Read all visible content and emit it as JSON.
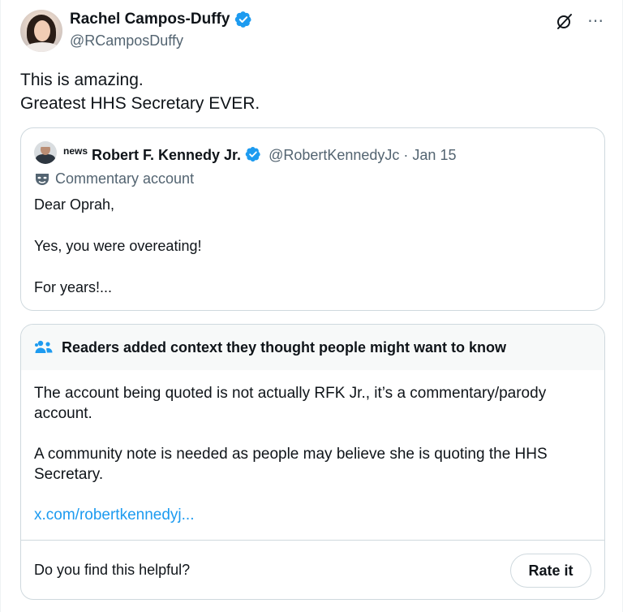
{
  "author": {
    "name": "Rachel Campos-Duffy",
    "handle": "@RCamposDuffy"
  },
  "tweet": {
    "lines": [
      "This is amazing.",
      "Greatest HHS Secretary EVER."
    ]
  },
  "quote": {
    "badge": "news",
    "name": "Robert F. Kennedy Jr.",
    "handle_date": "@RobertKennedyJc · Jan 15",
    "account_label": "Commentary account",
    "body": [
      "Dear Oprah,",
      "Yes, you were overeating!",
      "For years!..."
    ]
  },
  "community_note": {
    "title": "Readers added context they thought people might want to know",
    "paragraphs": [
      "The account being quoted is not actually RFK Jr., it’s a commentary/parody account.",
      "A community note is needed as people may believe she is quoting the HHS Secretary."
    ],
    "link": "x.com/robertkennedyj...",
    "helpful_prompt": "Do you find this helpful?",
    "rate_label": "Rate it"
  },
  "colors": {
    "verified_blue": "#1d9bf0",
    "secondary_text": "#536471",
    "border": "#cfd9de"
  },
  "icons": [
    "verified-badge-icon",
    "grok-icon",
    "more-icon",
    "mask-icon",
    "people-icon"
  ]
}
